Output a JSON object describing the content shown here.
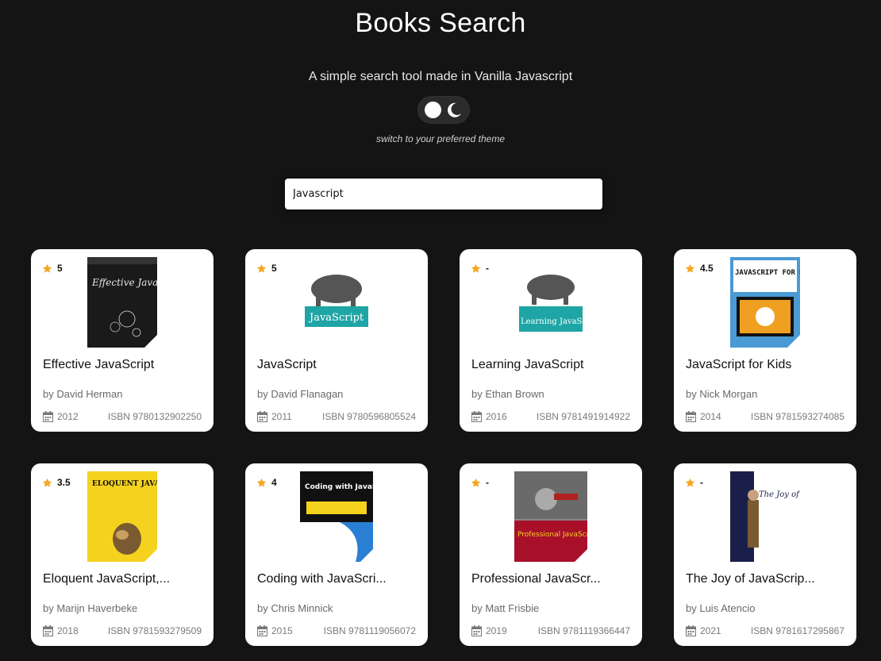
{
  "header": {
    "title": "Books Search",
    "subtitle": "A simple search tool made in Vanilla Javascript",
    "theme_hint": "switch to your preferred theme"
  },
  "search": {
    "value": "Javascript"
  },
  "colors": {
    "background": "#141414",
    "card": "#ffffff",
    "star": "#f5a623"
  },
  "isbn_label": "ISBN",
  "books": [
    {
      "rating": "5",
      "title": "Effective JavaScript",
      "author": "by David Herman",
      "year": "2012",
      "isbn": "9780132902250",
      "cover_text": "Effective JavaScript"
    },
    {
      "rating": "5",
      "title": "JavaScript",
      "author": "by David Flanagan",
      "year": "2011",
      "isbn": "9780596805524",
      "cover_text": "JavaScript"
    },
    {
      "rating": "-",
      "title": "Learning JavaScript",
      "author": "by Ethan Brown",
      "year": "2016",
      "isbn": "9781491914922",
      "cover_text": "Learning JavaScript"
    },
    {
      "rating": "4.5",
      "title": "JavaScript for Kids",
      "author": "by Nick Morgan",
      "year": "2014",
      "isbn": "9781593274085",
      "cover_text": "JAVASCRIPT FOR KIDS"
    },
    {
      "rating": "3.5",
      "title": "Eloquent JavaScript,...",
      "author": "by Marijn Haverbeke",
      "year": "2018",
      "isbn": "9781593279509",
      "cover_text": "ELOQUENT JAVASCRIPT"
    },
    {
      "rating": "4",
      "title": "Coding with JavaScri...",
      "author": "by Chris Minnick",
      "year": "2015",
      "isbn": "9781119056072",
      "cover_text": "Coding with JavaScript"
    },
    {
      "rating": "-",
      "title": "Professional JavaScr...",
      "author": "by Matt Frisbie",
      "year": "2019",
      "isbn": "9781119366447",
      "cover_text": "Professional JavaScript for Web Developers"
    },
    {
      "rating": "-",
      "title": "The Joy of JavaScrip...",
      "author": "by Luis Atencio",
      "year": "2021",
      "isbn": "9781617295867",
      "cover_text": "The Joy of JavaScript"
    }
  ]
}
